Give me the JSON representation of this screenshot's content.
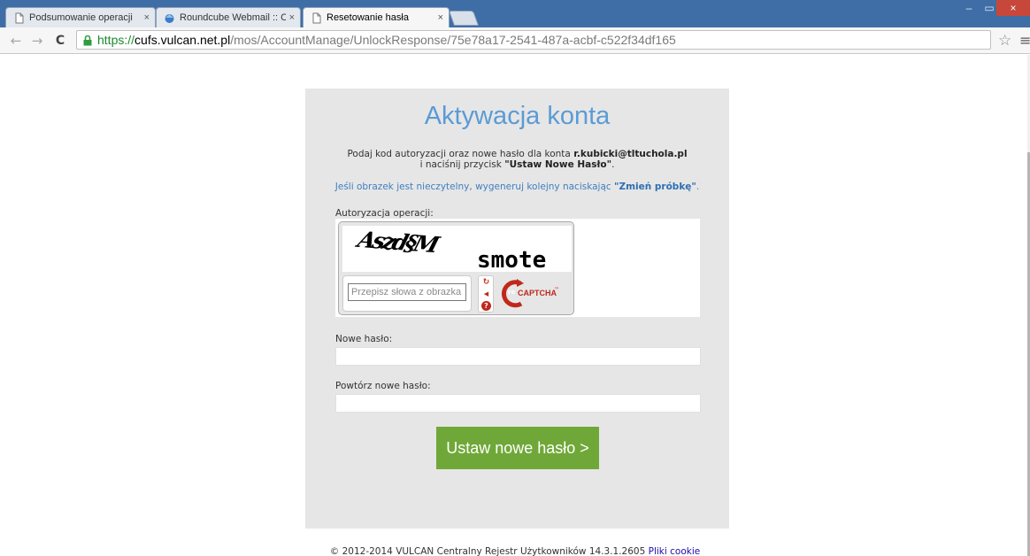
{
  "browser": {
    "tabs": [
      {
        "label": "Podsumowanie operacji",
        "close": "×",
        "icon": "document-icon"
      },
      {
        "label": "Roundcube Webmail :: Ce",
        "close": "×",
        "icon": "roundcube-icon"
      },
      {
        "label": "Resetowanie hasła",
        "close": "×",
        "icon": "document-icon"
      }
    ],
    "window_controls": {
      "minimize": "–",
      "maximize": "▭",
      "close": "×"
    },
    "nav": {
      "back": "←",
      "forward": "→",
      "reload": "C"
    },
    "url": {
      "scheme": "https://",
      "host": "cufs.vulcan.net.pl",
      "path": "/mos/AccountManage/UnlockResponse/75e78a17-2541-487a-acbf-c522f34df165"
    },
    "star": "☆",
    "menu": "≡"
  },
  "page": {
    "title": "Aktywacja konta",
    "instruction": {
      "line1_prefix": "Podaj kod autoryzacji oraz nowe hasło dla konta ",
      "email": "r.kubicki@tltuchola.pl",
      "line2_prefix": "i naciśnij przycisk ",
      "button_name": "\"Ustaw Nowe Hasło\"",
      "line2_suffix": "."
    },
    "hint": {
      "prefix": "Jeśli obrazek jest nieczytelny, wygeneruj kolejny naciskając ",
      "link": "\"Zmień próbkę\"",
      "suffix": "."
    },
    "captcha": {
      "label": "Autoryzacja operacji:",
      "word1": "Aszd§M",
      "word2": "smote",
      "placeholder": "Przepisz słowa z obrazka",
      "reload_glyph": "↻",
      "audio_glyph": "◀",
      "help_glyph": "?",
      "logo_re": "re",
      "logo_text": "CAPTCHA",
      "logo_tm": "™"
    },
    "new_password_label": "Nowe hasło:",
    "repeat_password_label": "Powtórz nowe hasło:",
    "submit_label": "Ustaw nowe hasło >",
    "footer": {
      "text": "© 2012-2014 VULCAN Centralny Rejestr Użytkowników 14.3.1.2605 ",
      "cookie_link": "Pliki cookie"
    }
  },
  "colors": {
    "accent": "#5b9bd5",
    "submit": "#6fa838",
    "link": "#3f7fc1",
    "tabstrip": "#3f6ea6"
  }
}
